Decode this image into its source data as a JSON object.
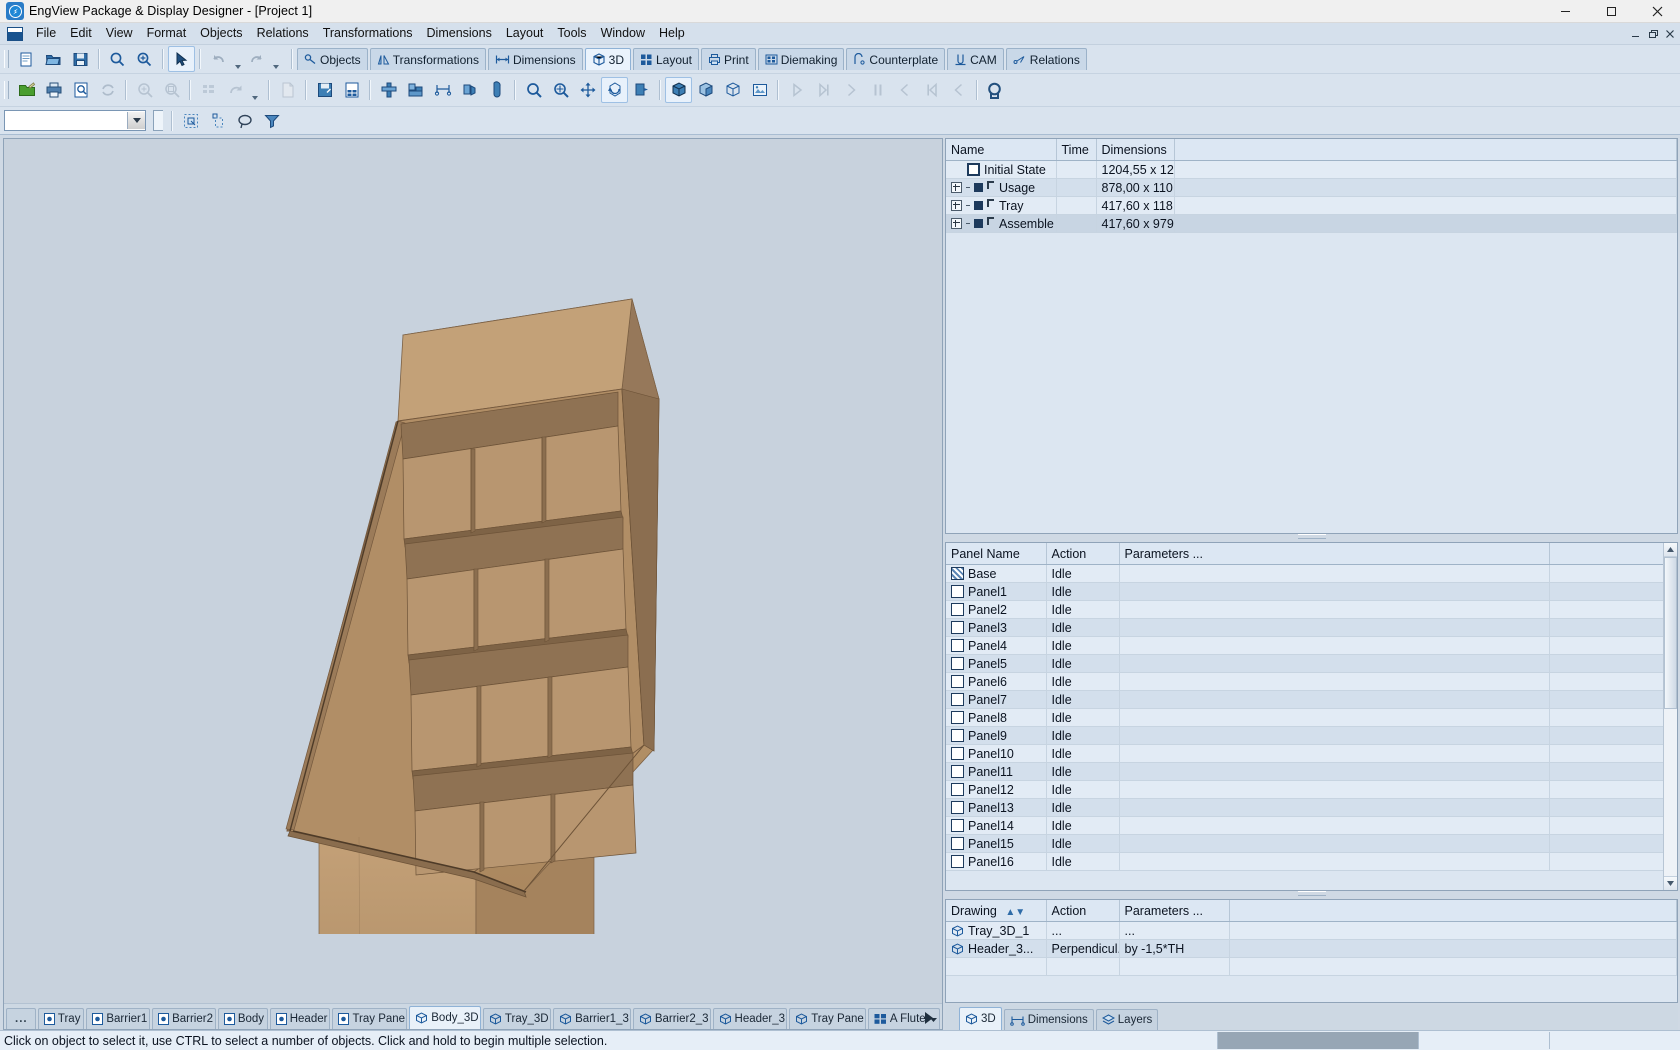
{
  "window": {
    "title": "EngView Package & Display Designer - [Project 1]",
    "app_icon": "engview-logo-icon",
    "controls": {
      "minimize": "minimize-icon",
      "maximize": "maximize-icon",
      "close": "close-icon"
    },
    "mdi_controls": {
      "minimize": "mdi-minimize-icon",
      "restore": "mdi-restore-icon",
      "close": "mdi-close-icon"
    }
  },
  "menubar": {
    "doc_icon": "document-icon",
    "items": [
      {
        "label": "File",
        "accel": "F"
      },
      {
        "label": "Edit",
        "accel": "E"
      },
      {
        "label": "View",
        "accel": "V"
      },
      {
        "label": "Format",
        "accel": "a"
      },
      {
        "label": "Objects",
        "accel": "b"
      },
      {
        "label": "Relations",
        "accel": "R"
      },
      {
        "label": "Transformations",
        "accel": "f"
      },
      {
        "label": "Dimensions",
        "accel": "D"
      },
      {
        "label": "Layout",
        "accel": "L"
      },
      {
        "label": "Tools",
        "accel": "T"
      },
      {
        "label": "Window",
        "accel": "W"
      },
      {
        "label": "Help",
        "accel": "H"
      }
    ]
  },
  "ribbon_tabs": [
    {
      "label": "Objects",
      "icon": "objects-icon",
      "active": false
    },
    {
      "label": "Transformations",
      "icon": "transformations-icon",
      "active": false
    },
    {
      "label": "Dimensions",
      "icon": "dimensions-icon",
      "active": false
    },
    {
      "label": "3D",
      "icon": "cube-3d-icon",
      "active": true
    },
    {
      "label": "Layout",
      "icon": "layout-grid-icon",
      "active": false
    },
    {
      "label": "Print",
      "icon": "print-icon",
      "active": false
    },
    {
      "label": "Diemaking",
      "icon": "diemaking-icon",
      "active": false
    },
    {
      "label": "Counterplate",
      "icon": "counterplate-icon",
      "active": false
    },
    {
      "label": "CAM",
      "icon": "cam-icon",
      "active": false
    },
    {
      "label": "Relations",
      "icon": "relations-icon",
      "active": false
    }
  ],
  "toolbar_standard": [
    {
      "name": "new-document-button",
      "icon": "new-document-icon",
      "enabled": true
    },
    {
      "name": "open-document-button",
      "icon": "open-folder-icon",
      "enabled": true
    },
    {
      "name": "save-document-button",
      "icon": "save-disk-icon",
      "enabled": true
    },
    {
      "name": "zoom-window-button",
      "icon": "magnifier-icon",
      "enabled": true
    },
    {
      "name": "zoom-in-button",
      "icon": "magnifier-plus-icon",
      "enabled": true
    },
    {
      "name": "select-arrow-button",
      "icon": "arrow-pointer-icon",
      "enabled": true
    },
    {
      "name": "undo-button",
      "icon": "undo-arrow-icon",
      "enabled": false
    },
    {
      "name": "redo-button",
      "icon": "redo-arrow-icon",
      "enabled": false
    }
  ],
  "toolbar_standard_row2": [
    {
      "name": "export-button",
      "icon": "export-green-folder-icon",
      "enabled": true
    },
    {
      "name": "print-button",
      "icon": "printer-icon",
      "enabled": true
    },
    {
      "name": "print-preview-button",
      "icon": "print-preview-icon",
      "enabled": true
    },
    {
      "name": "refresh-button",
      "icon": "refresh-arrows-icon",
      "enabled": false
    },
    {
      "name": "zoom-all-button",
      "icon": "zoom-all-icon",
      "enabled": false
    },
    {
      "name": "zoom-previous-button",
      "icon": "zoom-previous-icon",
      "enabled": false
    },
    {
      "name": "tile-button",
      "icon": "tile-grid-icon",
      "enabled": false
    },
    {
      "name": "redo-dropdown-button",
      "icon": "redo-arrow-icon",
      "enabled": false
    }
  ],
  "toolbar_3d": [
    {
      "name": "new-3d-view-button",
      "icon": "page-blank-icon",
      "enabled": false
    },
    {
      "name": "save-3d-button",
      "icon": "save-3d-icon",
      "enabled": true
    },
    {
      "name": "report-button",
      "icon": "report-page-icon",
      "enabled": true
    },
    {
      "name": "assemble-button",
      "icon": "assemble-icon",
      "enabled": true
    },
    {
      "name": "stack-button",
      "icon": "stack-boxes-icon",
      "enabled": true
    },
    {
      "name": "measure-button",
      "icon": "measure-icon",
      "enabled": true
    },
    {
      "name": "fold-preview-button",
      "icon": "fold-preview-icon",
      "enabled": true
    },
    {
      "name": "fill-button",
      "icon": "fill-shape-icon",
      "enabled": true
    },
    {
      "name": "zoom-tool-button",
      "icon": "magnifier-icon",
      "enabled": true
    },
    {
      "name": "zoom-extent-button",
      "icon": "magnifier-move-icon",
      "enabled": true
    },
    {
      "name": "pan-button",
      "icon": "pan-arrows-icon",
      "enabled": true
    },
    {
      "name": "rotate-3d-button",
      "icon": "rotate-3d-icon",
      "active": true,
      "enabled": true
    },
    {
      "name": "fold-angle-button",
      "icon": "fold-angle-icon",
      "enabled": true
    },
    {
      "name": "solid-view-button",
      "icon": "solid-cube-icon",
      "active": true,
      "enabled": true
    },
    {
      "name": "shaded-view-button",
      "icon": "shaded-cube-icon",
      "enabled": true
    },
    {
      "name": "wireframe-view-button",
      "icon": "wireframe-cube-icon",
      "enabled": true
    },
    {
      "name": "image-view-button",
      "icon": "image-frame-icon",
      "enabled": true
    },
    {
      "name": "play-button",
      "icon": "play-icon",
      "enabled": false
    },
    {
      "name": "play-to-end-button",
      "icon": "play-end-icon",
      "enabled": false
    },
    {
      "name": "step-forward-button",
      "icon": "step-forward-icon",
      "enabled": false
    },
    {
      "name": "pause-button",
      "icon": "pause-icon",
      "enabled": false
    },
    {
      "name": "step-back-button",
      "icon": "step-back-icon",
      "enabled": false
    },
    {
      "name": "rewind-button",
      "icon": "rewind-icon",
      "enabled": false
    },
    {
      "name": "previous-button",
      "icon": "previous-icon",
      "enabled": false
    },
    {
      "name": "search-3d-button",
      "icon": "magnifier-dark-icon",
      "enabled": true
    }
  ],
  "layer_toolbar": {
    "combo_value": "",
    "combo_placeholder": "",
    "buttons": [
      {
        "name": "select-by-region-button",
        "icon": "select-region-icon"
      },
      {
        "name": "select-single-button",
        "icon": "select-single-icon"
      },
      {
        "name": "lasso-select-button",
        "icon": "lasso-icon"
      },
      {
        "name": "filter-button",
        "icon": "funnel-icon"
      }
    ]
  },
  "tree_panel": {
    "columns": [
      "Name",
      "Time",
      "Dimensions"
    ],
    "rows": [
      {
        "name": "Initial State",
        "time": "",
        "dimensions": "1204,55 x 12...",
        "indent": 1,
        "marker": "square-hollow",
        "expandable": false,
        "corner": false
      },
      {
        "name": "Usage",
        "time": "",
        "dimensions": "878,00 x 110...",
        "indent": 0,
        "marker": "square-filled",
        "expandable": true,
        "corner": true
      },
      {
        "name": "Tray",
        "time": "",
        "dimensions": "417,60 x 118...",
        "indent": 0,
        "marker": "square-filled",
        "expandable": true,
        "corner": true
      },
      {
        "name": "Assemble",
        "time": "",
        "dimensions": "417,60 x 979,...",
        "indent": 0,
        "marker": "square-filled",
        "expandable": true,
        "corner": true,
        "selected": true
      }
    ]
  },
  "panels_panel": {
    "columns": [
      "Panel Name",
      "Action",
      "Parameters ..."
    ],
    "rows": [
      {
        "panel": "Base",
        "action": "Idle",
        "params": "",
        "checkbox": "hatched"
      },
      {
        "panel": "Panel1",
        "action": "Idle",
        "params": "",
        "checkbox": "empty"
      },
      {
        "panel": "Panel2",
        "action": "Idle",
        "params": "",
        "checkbox": "empty"
      },
      {
        "panel": "Panel3",
        "action": "Idle",
        "params": "",
        "checkbox": "empty"
      },
      {
        "panel": "Panel4",
        "action": "Idle",
        "params": "",
        "checkbox": "empty"
      },
      {
        "panel": "Panel5",
        "action": "Idle",
        "params": "",
        "checkbox": "empty"
      },
      {
        "panel": "Panel6",
        "action": "Idle",
        "params": "",
        "checkbox": "empty"
      },
      {
        "panel": "Panel7",
        "action": "Idle",
        "params": "",
        "checkbox": "empty"
      },
      {
        "panel": "Panel8",
        "action": "Idle",
        "params": "",
        "checkbox": "empty"
      },
      {
        "panel": "Panel9",
        "action": "Idle",
        "params": "",
        "checkbox": "empty"
      },
      {
        "panel": "Panel10",
        "action": "Idle",
        "params": "",
        "checkbox": "empty"
      },
      {
        "panel": "Panel11",
        "action": "Idle",
        "params": "",
        "checkbox": "empty"
      },
      {
        "panel": "Panel12",
        "action": "Idle",
        "params": "",
        "checkbox": "empty"
      },
      {
        "panel": "Panel13",
        "action": "Idle",
        "params": "",
        "checkbox": "empty"
      },
      {
        "panel": "Panel14",
        "action": "Idle",
        "params": "",
        "checkbox": "empty"
      },
      {
        "panel": "Panel15",
        "action": "Idle",
        "params": "",
        "checkbox": "empty"
      },
      {
        "panel": "Panel16",
        "action": "Idle",
        "params": "",
        "checkbox": "empty"
      }
    ]
  },
  "drawings_panel": {
    "columns": [
      "Drawing",
      "Action",
      "Parameters ..."
    ],
    "sort_icon": "sort-updown-icon",
    "rows": [
      {
        "drawing": "Tray_3D_1",
        "action": "...",
        "params": "...",
        "icon": "cube-3d-icon"
      },
      {
        "drawing": "Header_3...",
        "action": "Perpendicul...",
        "params": "by -1,5*TH",
        "icon": "cube-3d-icon"
      }
    ]
  },
  "document_tabs": {
    "overflow_label": "...",
    "items": [
      {
        "label": "Tray",
        "icon": "drawing-2d-icon",
        "active": false
      },
      {
        "label": "Barrier1",
        "icon": "drawing-2d-icon",
        "active": false
      },
      {
        "label": "Barrier2",
        "icon": "drawing-2d-icon",
        "active": false
      },
      {
        "label": "Body",
        "icon": "drawing-2d-icon",
        "active": false
      },
      {
        "label": "Header",
        "icon": "drawing-2d-icon",
        "active": false
      },
      {
        "label": "Tray Pane",
        "icon": "drawing-2d-icon",
        "active": false
      },
      {
        "label": "Body_3D",
        "icon": "cube-3d-icon",
        "active": true
      },
      {
        "label": "Tray_3D",
        "icon": "cube-3d-icon",
        "active": false
      },
      {
        "label": "Barrier1_3",
        "icon": "cube-3d-icon",
        "active": false
      },
      {
        "label": "Barrier2_3",
        "icon": "cube-3d-icon",
        "active": false
      },
      {
        "label": "Header_3",
        "icon": "cube-3d-icon",
        "active": false
      },
      {
        "label": "Tray Pane",
        "icon": "cube-3d-icon",
        "active": false
      },
      {
        "label": "A Flute",
        "icon": "board-grid-icon",
        "active": false,
        "dropdown": true
      }
    ]
  },
  "right_tabs": [
    {
      "label": "3D",
      "icon": "cube-3d-icon",
      "active": true
    },
    {
      "label": "Dimensions",
      "icon": "dimensions-icon",
      "active": false
    },
    {
      "label": "Layers",
      "icon": "layers-icon",
      "active": false
    }
  ],
  "status_bar": {
    "message": "Click on object to select it, use CTRL to select a number of objects. Click and hold to begin multiple selection."
  },
  "colors": {
    "cardboard_light": "#c8a277",
    "cardboard_mid": "#b08f68",
    "cardboard_dark": "#9c7d5a",
    "cardboard_inner": "#8d7051",
    "canvas_bg": "#c8d2dd",
    "accent": "#1d5a9c",
    "selection": "#c8d5e3"
  }
}
